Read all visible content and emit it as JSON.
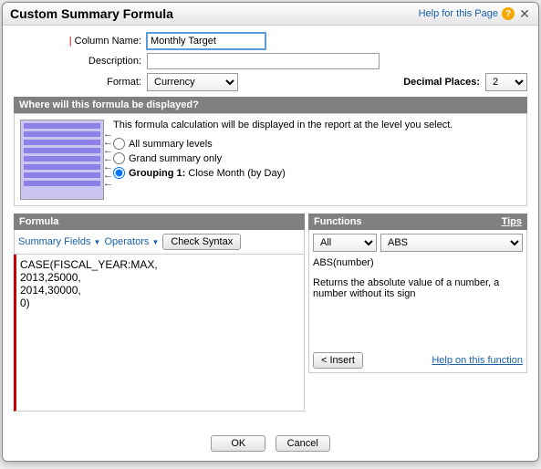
{
  "title": "Custom Summary Formula",
  "helpLink": "Help for this Page",
  "labels": {
    "columnName": "Column Name:",
    "description": "Description:",
    "format": "Format:",
    "decimals": "Decimal Places:"
  },
  "values": {
    "columnName": "Monthly Target",
    "description": "",
    "format": "Currency",
    "decimals": "2"
  },
  "displaySection": {
    "header": "Where will this formula be displayed?",
    "intro": "This formula calculation will be displayed in the report at the level you select.",
    "opt1": "All summary levels",
    "opt2": "Grand summary only",
    "opt3_pre": "Grouping 1:",
    "opt3_suf": " Close Month (by Day)",
    "selected": "g1"
  },
  "formulaSection": {
    "header": "Formula",
    "summaryFields": "Summary Fields",
    "operators": "Operators",
    "checkSyntax": "Check Syntax",
    "text": "CASE(FISCAL_YEAR:MAX,\n2013,25000,\n2014,30000,\n0)"
  },
  "functions": {
    "header": "Functions",
    "tips": "Tips",
    "category": "All",
    "selected": "ABS",
    "sig": "ABS(number)",
    "desc": "Returns the absolute value of a number, a number without its sign",
    "insert": "< Insert",
    "helpFn": "Help on this function"
  },
  "footer": {
    "ok": "OK",
    "cancel": "Cancel"
  }
}
